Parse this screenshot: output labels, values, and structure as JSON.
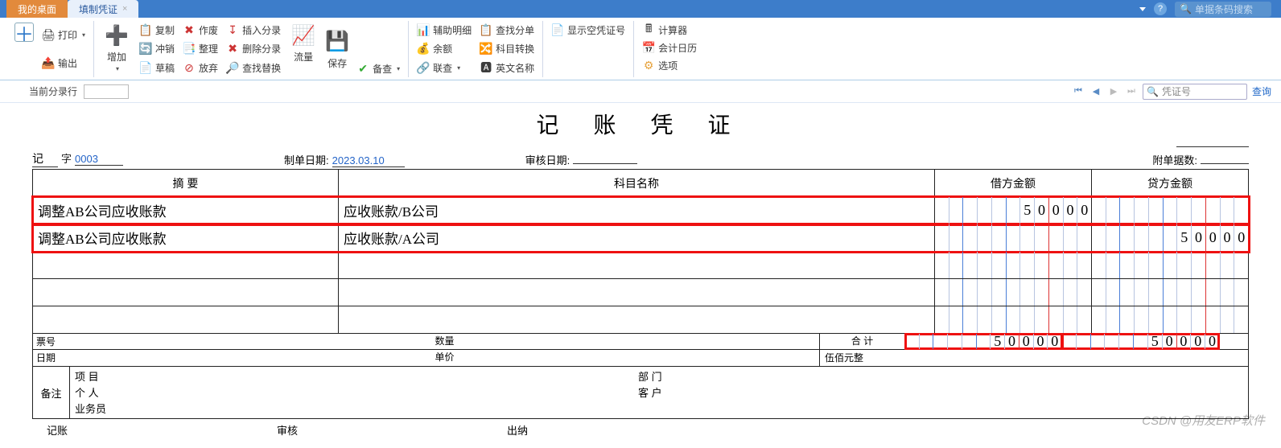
{
  "tabs": {
    "desktop": "我的桌面",
    "fill": "填制凭证"
  },
  "topsearch": {
    "placeholder": "单据条码搜索"
  },
  "ribbon": {
    "add": "增加",
    "print": "打印",
    "output": "输出",
    "copy": "复制",
    "offset": "冲销",
    "draft": "草稿",
    "void": "作废",
    "tidy": "整理",
    "abandon": "放弃",
    "insEntry": "插入分录",
    "delEntry": "删除分录",
    "findReplace": "查找替换",
    "flow": "流量",
    "save": "保存",
    "backup": "备查",
    "auxDetail": "辅助明细",
    "balance": "余额",
    "contact": "联查",
    "findSplit": "查找分单",
    "subjTrans": "科目转换",
    "engName": "英文名称",
    "showEmpty": "显示空凭证号",
    "calc": "计算器",
    "acctCal": "会计日历",
    "options": "选项"
  },
  "subbar": {
    "currentLine": "当前分录行",
    "voucherNoPh": "凭证号",
    "query": "查询"
  },
  "voucher": {
    "title": "记 账 凭 证",
    "ji": "记",
    "zi": "字",
    "no": "0003",
    "makeDateLbl": "制单日期:",
    "makeDate": "2023.03.10",
    "auditDateLbl": "审核日期:",
    "attachLbl": "附单据数:",
    "head": {
      "summary": "摘 要",
      "account": "科目名称",
      "debit": "借方金额",
      "credit": "贷方金额"
    },
    "rows": [
      {
        "summary": "调整AB公司应收账款",
        "account": "应收账款/B公司",
        "debit": "50000",
        "credit": ""
      },
      {
        "summary": "调整AB公司应收账款",
        "account": "应收账款/A公司",
        "debit": "",
        "credit": "50000"
      }
    ],
    "totalLbl": "合 计",
    "totalDebit": "50000",
    "totalCredit": "50000",
    "amountWords": "伍佰元整",
    "billNo": "票号",
    "date": "日期",
    "qty": "数量",
    "price": "单价",
    "remarkLbl": "备注",
    "proj": "项 目",
    "dept": "部 门",
    "person": "个 人",
    "cust": "客 户",
    "biz": "业务员",
    "signBook": "记账",
    "signAudit": "审核",
    "signCashier": "出纳"
  },
  "watermark": "CSDN @用友ERP软件"
}
